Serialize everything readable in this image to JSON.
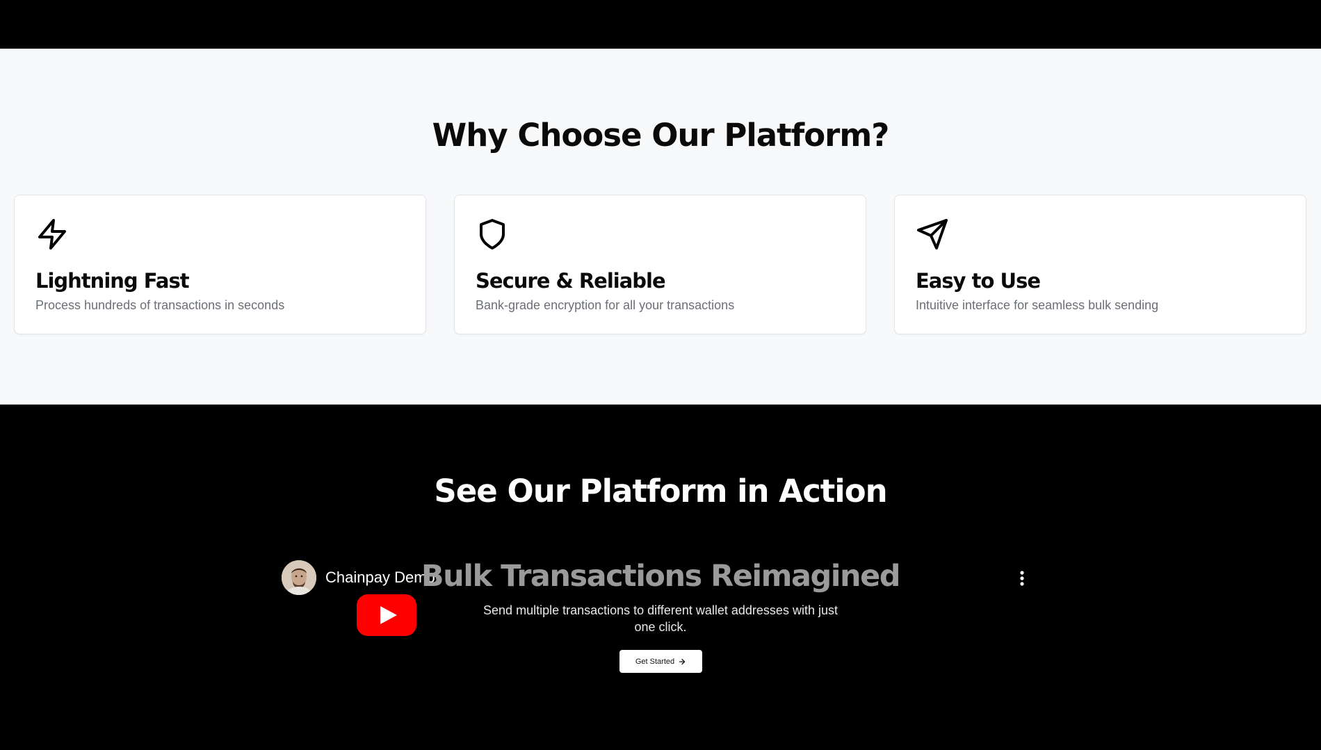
{
  "features": {
    "title": "Why Choose Our Platform?",
    "cards": [
      {
        "icon": "lightning-icon",
        "title": "Lightning Fast",
        "description": "Process hundreds of transactions in seconds"
      },
      {
        "icon": "shield-icon",
        "title": "Secure & Reliable",
        "description": "Bank-grade encryption for all your transactions"
      },
      {
        "icon": "send-icon",
        "title": "Easy to Use",
        "description": "Intuitive interface for seamless bulk sending"
      }
    ]
  },
  "demo": {
    "title": "See Our Platform in Action",
    "video": {
      "channel_name": "Chainpay Demo",
      "headline": "Bulk Transactions Reimagined",
      "subtitle": "Send multiple transactions to different wallet addresses with just one click.",
      "button_label": "Get Started",
      "play_icon": "youtube-play-icon",
      "menu_icon": "more-vertical-icon"
    }
  },
  "colors": {
    "page_black": "#000000",
    "features_background": "#f8f9fa",
    "card_background": "#ffffff",
    "youtube_red": "#ff0000"
  }
}
